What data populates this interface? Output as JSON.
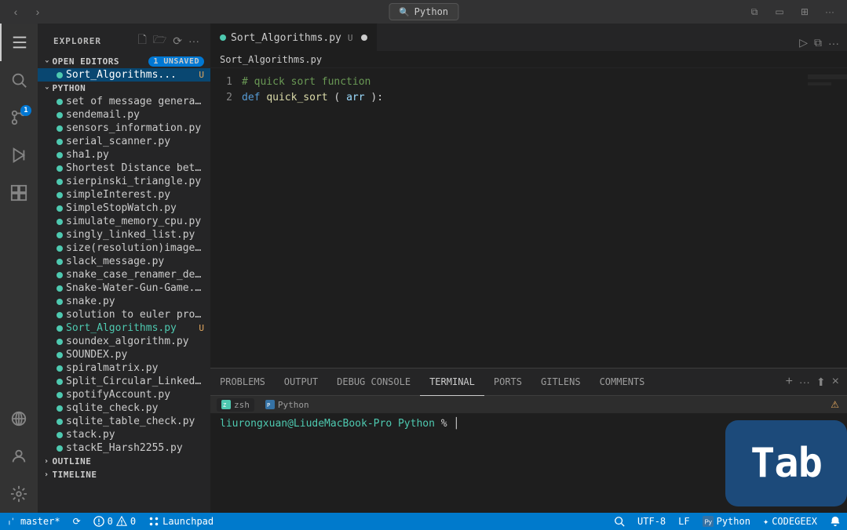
{
  "titleBar": {
    "title": "Python",
    "searchPlaceholder": "Python"
  },
  "activityBar": {
    "items": [
      {
        "name": "explorer",
        "icon": "⊞",
        "active": true
      },
      {
        "name": "search",
        "icon": "🔍"
      },
      {
        "name": "source-control",
        "icon": "⑂",
        "badge": "1"
      },
      {
        "name": "run-debug",
        "icon": "▷"
      },
      {
        "name": "extensions",
        "icon": "⊞"
      },
      {
        "name": "remote-explorer",
        "icon": "⊙"
      },
      {
        "name": "accounts",
        "icon": "👤"
      },
      {
        "name": "settings",
        "icon": "⚙"
      }
    ]
  },
  "sidebar": {
    "title": "EXPLORER",
    "openEditors": {
      "label": "OPEN EDITORS",
      "badge": "1 Unsaved",
      "files": [
        {
          "name": "Sort_Algorithms...",
          "suffix": "U",
          "active": true
        }
      ]
    },
    "python": {
      "label": "PYTHON",
      "files": [
        "set of message generate...",
        "sendemail.py",
        "sensors_information.py",
        "serial_scanner.py",
        "sha1.py",
        "Shortest Distance betwe...",
        "sierpinski_triangle.py",
        "simpleInterest.py",
        "SimpleStopWatch.py",
        "simulate_memory_cpu.py",
        "singly_linked_list.py",
        "size(resolution)image.py",
        "slack_message.py",
        "snake_case_renamer_dep...",
        "Snake-Water-Gun-Game.py",
        "snake.py",
        "solution to euler project pr...",
        "Sort_Algorithms.py",
        "soundex_algorithm.py",
        "SOUNDEX.py",
        "spiralmatrix.py",
        "Split_Circular_Linked_List...",
        "spotifyAccount.py",
        "sqlite_check.py",
        "sqlite_table_check.py",
        "stack.py",
        "stackE_Harsh2255.py"
      ]
    },
    "outline": {
      "label": "OUTLINE"
    },
    "timeline": {
      "label": "TIMELINE"
    }
  },
  "editor": {
    "tab": {
      "filename": "Sort_Algorithms.py",
      "prefix": "U",
      "unsaved": true
    },
    "breadcrumb": "Sort_Algorithms.py",
    "lines": [
      {
        "num": "1",
        "content": "# quick sort function",
        "type": "comment"
      },
      {
        "num": "2",
        "content": "def quick_sort(arr):",
        "type": "code"
      }
    ]
  },
  "terminal": {
    "tabs": [
      {
        "label": "PROBLEMS"
      },
      {
        "label": "OUTPUT"
      },
      {
        "label": "DEBUG CONSOLE"
      },
      {
        "label": "TERMINAL",
        "active": true
      },
      {
        "label": "PORTS"
      },
      {
        "label": "GITLENS"
      },
      {
        "label": "COMMENTS"
      }
    ],
    "subTabs": [
      {
        "label": "zsh"
      },
      {
        "label": "Python"
      }
    ],
    "prompt": "liurongxuan@LiudeMacBook-Pro Python % "
  },
  "statusBar": {
    "branch": "master*",
    "sync": "⟳",
    "errors": "⊗ 0",
    "warnings": "⚠ 0",
    "launchpad": "Launchpad",
    "encoding": "UTF-8",
    "lineEnding": "LF",
    "language": "Python",
    "codegeex": "✦ CODEGEEX",
    "search": "🔍",
    "notifications": "🔔"
  },
  "tabOverlay": {
    "label": "Tab"
  }
}
